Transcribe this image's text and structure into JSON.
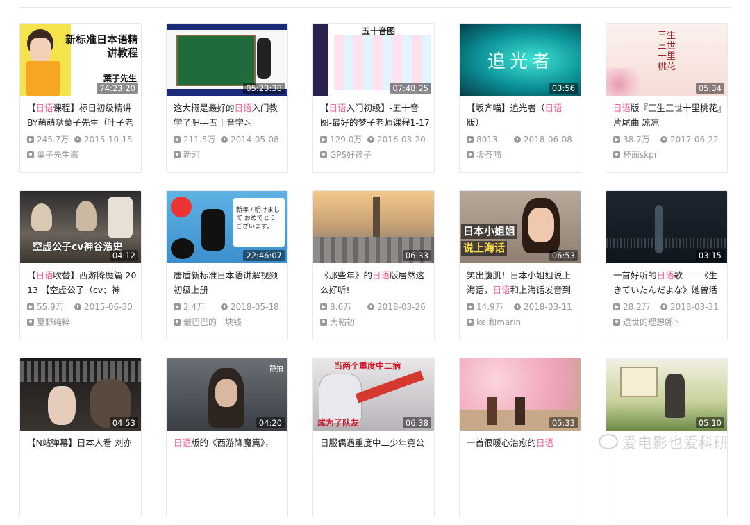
{
  "cards": [
    {
      "title_parts": [
        {
          "t": "【"
        },
        {
          "t": "日语",
          "hl": true
        },
        {
          "t": "课程】标日初级精讲BY萌萌哒葉子先生（叶子老"
        }
      ],
      "duration": "74:23:20",
      "views": "245.7万",
      "date": "2015-10-15",
      "author": "葉子先生酱",
      "thumb": {
        "title": "新标准日本语精讲教程",
        "sub": "葉子先生"
      }
    },
    {
      "title_parts": [
        {
          "t": "这大概是最好的"
        },
        {
          "t": "日语",
          "hl": true
        },
        {
          "t": "入门教学了吧---五十音学习"
        }
      ],
      "duration": "05:23:38",
      "views": "211.5万",
      "date": "2014-05-08",
      "author": "新河",
      "thumb": {
        "title": "",
        "sub": ""
      }
    },
    {
      "title_parts": [
        {
          "t": "【"
        },
        {
          "t": "日语",
          "hl": true
        },
        {
          "t": "入门初级】-五十音图-最好的梦子老师课程1-17"
        }
      ],
      "duration": "07:48:25",
      "views": "129.0万",
      "date": "2016-03-20",
      "author": "GPS好孩子",
      "thumb": {
        "title": "五十音图",
        "sub": ""
      }
    },
    {
      "title_parts": [
        {
          "t": "【坂齐喵】追光者（"
        },
        {
          "t": "日语",
          "hl": true
        },
        {
          "t": "版）"
        }
      ],
      "duration": "03:56",
      "views": "8013",
      "date": "2018-06-08",
      "author": "坂齐喵",
      "thumb": {
        "title": "追光者",
        "sub": ""
      }
    },
    {
      "title_parts": [
        {
          "t": "日语",
          "hl": true
        },
        {
          "t": "版『三生三世十里桃花』片尾曲 凉凉"
        }
      ],
      "duration": "05:34",
      "views": "38.7万",
      "date": "2017-06-22",
      "author": "杯面skpr",
      "thumb": {
        "title": "三生三世十里桃花",
        "sub": ""
      }
    },
    {
      "title_parts": [
        {
          "t": "【"
        },
        {
          "t": "日语",
          "hl": true
        },
        {
          "t": "吹替】西游降魔篇 2013 【空虚公子（cv：神"
        }
      ],
      "duration": "04:12",
      "views": "55.9万",
      "date": "2015-06-30",
      "author": "夏野纯粹",
      "thumb": {
        "title": "空虚公子cv神谷浩史",
        "sub": ""
      }
    },
    {
      "title_parts": [
        {
          "t": "唐盾新标准日本语讲解视频初级上册"
        }
      ],
      "duration": "22:46:07",
      "views": "2.4万",
      "date": "2018-05-18",
      "author": "皱巴巴的一块钱",
      "thumb": {
        "title": "",
        "sub": "新年 / 明けまして おめでとう ございます。"
      }
    },
    {
      "title_parts": [
        {
          "t": "《那些年》的"
        },
        {
          "t": "日语",
          "hl": true
        },
        {
          "t": "版居然这么好听!"
        }
      ],
      "duration": "06:33",
      "views": "8.6万",
      "date": "2018-03-26",
      "author": "大粘初一",
      "thumb": {
        "title": "",
        "sub": ""
      }
    },
    {
      "title_parts": [
        {
          "t": "笑出腹肌！日本小姐姐说上海话，"
        },
        {
          "t": "日语",
          "hl": true
        },
        {
          "t": "和上海话发音到"
        }
      ],
      "duration": "06:53",
      "views": "14.9万",
      "date": "2018-03-11",
      "author": "kei和marin",
      "thumb": {
        "title": "日本小姐姐",
        "sub": "说上海话"
      }
    },
    {
      "title_parts": [
        {
          "t": "一首好听的"
        },
        {
          "t": "日语",
          "hl": true
        },
        {
          "t": "歌——《生きていたんだよな》她曾活"
        }
      ],
      "duration": "03:15",
      "views": "28.2万",
      "date": "2018-03-31",
      "author": "遗世的理想娜丶",
      "thumb": {
        "title": "",
        "sub": ""
      }
    },
    {
      "title_parts": [
        {
          "t": "【N站弹幕】日本人看 刘亦"
        }
      ],
      "duration": "04:53",
      "views": "",
      "date": "",
      "author": "",
      "thumb": {
        "title": "",
        "sub": ""
      }
    },
    {
      "title_parts": [
        {
          "t": "日语",
          "hl": true
        },
        {
          "t": "版的《西游降魔篇》，"
        }
      ],
      "duration": "04:20",
      "views": "",
      "date": "",
      "author": "",
      "thumb": {
        "title": "",
        "sub": "静拍"
      }
    },
    {
      "title_parts": [
        {
          "t": "日服偶遇重度中二少年竟公"
        }
      ],
      "duration": "06:38",
      "views": "",
      "date": "",
      "author": "",
      "thumb": {
        "title": "当两个重度中二病",
        "sub": "成为了队友"
      }
    },
    {
      "title_parts": [
        {
          "t": "一首很暖心治愈的"
        },
        {
          "t": "日语",
          "hl": true
        }
      ],
      "duration": "05:33",
      "views": "",
      "date": "",
      "author": "",
      "thumb": {
        "title": "",
        "sub": ""
      }
    },
    {
      "title_parts": [
        {
          "t": ""
        }
      ],
      "duration": "05:10",
      "views": "",
      "date": "",
      "author": "",
      "thumb": {
        "title": "",
        "sub": ""
      }
    }
  ],
  "watermark": "爱电影也爱科研",
  "colors": {
    "highlight": "#f25d8e",
    "meta": "#999999",
    "border": "#e5e9ef"
  }
}
